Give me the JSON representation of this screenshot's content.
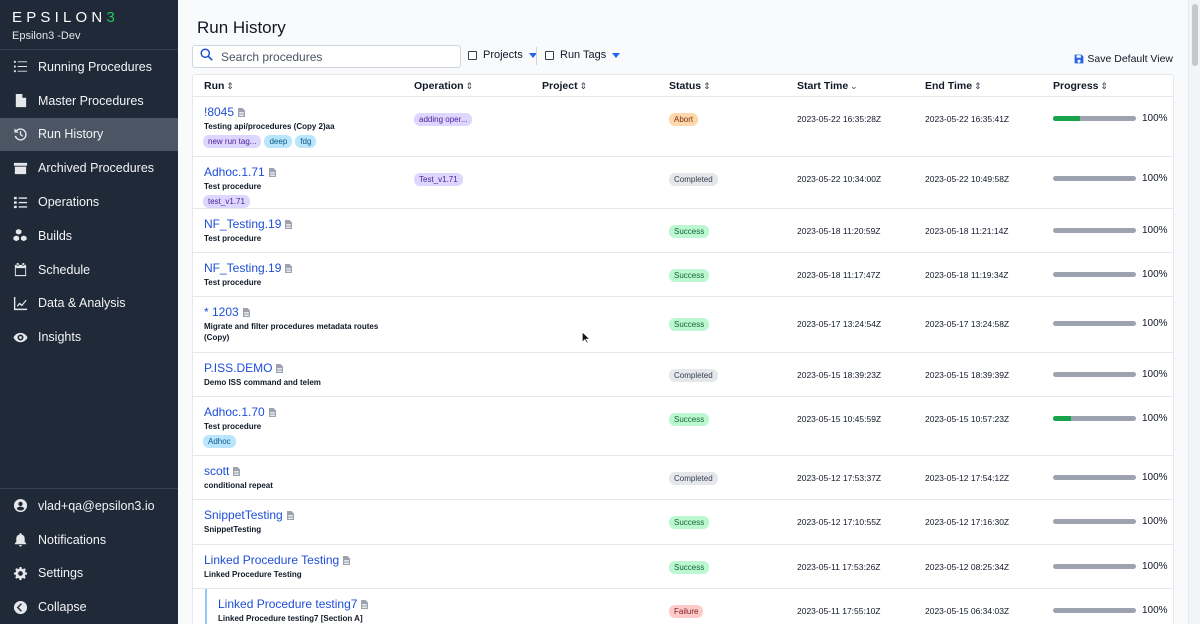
{
  "app": {
    "logo_main": "EPSILON",
    "logo_accent": "3",
    "environment": "Epsilon3 -Dev"
  },
  "sidebar": {
    "items": [
      {
        "label": "Running Procedures",
        "icon": "list-check-icon",
        "active": false
      },
      {
        "label": "Master Procedures",
        "icon": "document-icon",
        "active": false
      },
      {
        "label": "Run History",
        "icon": "history-icon",
        "active": true
      },
      {
        "label": "Archived Procedures",
        "icon": "archive-icon",
        "active": false
      },
      {
        "label": "Operations",
        "icon": "list-icon",
        "active": false
      },
      {
        "label": "Builds",
        "icon": "cubes-icon",
        "active": false
      },
      {
        "label": "Schedule",
        "icon": "calendar-icon",
        "active": false
      },
      {
        "label": "Data & Analysis",
        "icon": "chart-line-icon",
        "active": false
      },
      {
        "label": "Insights",
        "icon": "eye-icon",
        "active": false
      }
    ],
    "bottom_items": [
      {
        "label": "vlad+qa@epsilon3.io",
        "icon": "user-circle-icon"
      },
      {
        "label": "Notifications",
        "icon": "bell-icon"
      },
      {
        "label": "Settings",
        "icon": "gear-icon"
      },
      {
        "label": "Collapse",
        "icon": "arrow-left-circle-icon"
      }
    ]
  },
  "header": {
    "title": "Run History",
    "search_placeholder": "Search procedures",
    "filter_projects": "Projects",
    "filter_run_tags": "Run Tags",
    "save_view": "Save Default View"
  },
  "table": {
    "columns": [
      "Run",
      "Operation",
      "Project",
      "Status",
      "Start Time",
      "End Time",
      "Progress"
    ],
    "rows": [
      {
        "run": "!8045",
        "procedure": "Testing api/procedures (Copy 2)aa",
        "tags": [
          {
            "label": "new run tag...",
            "color": "purple"
          },
          {
            "label": "deep",
            "color": "blue"
          },
          {
            "label": "fdg",
            "color": "blue"
          }
        ],
        "operation": "adding oper...",
        "status": "Abort",
        "status_type": "abort",
        "start": "2023-05-22 16:35:28Z",
        "end": "2023-05-22 16:35:41Z",
        "progress_fill": 0.33,
        "progress": "100%"
      },
      {
        "run": "Adhoc.1.71",
        "procedure": "Test procedure",
        "tags": [
          {
            "label": "test_v1.71",
            "color": "purple"
          }
        ],
        "operation": "Test_v1.71",
        "status": "Completed",
        "status_type": "completed",
        "start": "2023-05-22 10:34:00Z",
        "end": "2023-05-22 10:49:58Z",
        "progress_fill": 0,
        "progress": "100%"
      },
      {
        "run": "NF_Testing.19",
        "procedure": "Test procedure",
        "tags": [],
        "operation": "",
        "status": "Success",
        "status_type": "success",
        "start": "2023-05-18 11:20:59Z",
        "end": "2023-05-18 11:21:14Z",
        "progress_fill": 0,
        "progress": "100%"
      },
      {
        "run": "NF_Testing.19",
        "procedure": "Test procedure",
        "tags": [],
        "operation": "",
        "status": "Success",
        "status_type": "success",
        "start": "2023-05-18 11:17:47Z",
        "end": "2023-05-18 11:19:34Z",
        "progress_fill": 0,
        "progress": "100%"
      },
      {
        "run": "* 1203",
        "procedure": "Migrate and filter procedures metadata routes (Copy)",
        "tags": [],
        "operation": "",
        "status": "Success",
        "status_type": "success",
        "start": "2023-05-17 13:24:54Z",
        "end": "2023-05-17 13:24:58Z",
        "progress_fill": 0,
        "progress": "100%"
      },
      {
        "run": "P.ISS.DEMO",
        "procedure": "Demo ISS command and telem",
        "tags": [],
        "operation": "",
        "status": "Completed",
        "status_type": "completed",
        "start": "2023-05-15 18:39:23Z",
        "end": "2023-05-15 18:39:39Z",
        "progress_fill": 0,
        "progress": "100%"
      },
      {
        "run": "Adhoc.1.70",
        "procedure": "Test procedure",
        "tags": [
          {
            "label": "Adhoc",
            "color": "blue"
          }
        ],
        "operation": "",
        "status": "Success",
        "status_type": "success",
        "start": "2023-05-15 10:45:59Z",
        "end": "2023-05-15 10:57:23Z",
        "progress_fill": 0.22,
        "progress": "100%"
      },
      {
        "run": "scott",
        "procedure": "conditional repeat",
        "tags": [],
        "operation": "",
        "status": "Completed",
        "status_type": "completed",
        "start": "2023-05-12 17:53:37Z",
        "end": "2023-05-12 17:54:12Z",
        "progress_fill": 0,
        "progress": "100%"
      },
      {
        "run": "SnippetTesting",
        "procedure": "SnippetTesting",
        "tags": [],
        "operation": "",
        "status": "Success",
        "status_type": "success",
        "start": "2023-05-12 17:10:55Z",
        "end": "2023-05-12 17:16:30Z",
        "progress_fill": 0,
        "progress": "100%"
      },
      {
        "run": "Linked Procedure Testing",
        "procedure": "Linked Procedure Testing",
        "tags": [],
        "operation": "",
        "status": "Success",
        "status_type": "success",
        "start": "2023-05-11 17:53:26Z",
        "end": "2023-05-12 08:25:34Z",
        "progress_fill": 0,
        "progress": "100%"
      },
      {
        "run": "Linked Procedure testing7",
        "procedure": "Linked Procedure testing7 [Section A]",
        "tags": [],
        "operation": "",
        "status": "Failure",
        "status_type": "failure",
        "start": "2023-05-11 17:55:10Z",
        "end": "2023-05-15 06:34:03Z",
        "progress_fill": 0,
        "progress": "100%",
        "child": true
      }
    ]
  }
}
